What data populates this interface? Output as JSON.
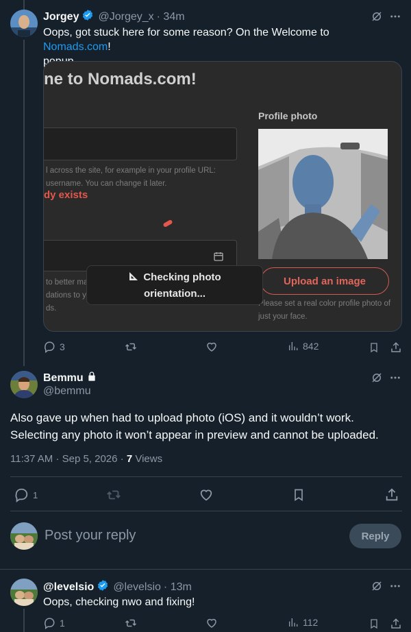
{
  "tweet1": {
    "name": "Jorgey",
    "handle": "@Jorgey_x",
    "time": "· 34m",
    "text_before": "Oops, got stuck here for some reason? On the Welcome to ",
    "text_link": "Nomads.com",
    "text_after": "!",
    "text_line2": "popup.",
    "embed": {
      "title": "ne to Nomads.com!",
      "help_1a": "l across the site, for example in your profile URL:",
      "help_1b": "username. You can change it later.",
      "error": "dy exists",
      "help_2a": "to better ma",
      "help_2b": "dations to yo",
      "help_2c": "ds.",
      "profile_photo_label": "Profile photo",
      "toast_line1": "Checking photo",
      "toast_line2": "orientation...",
      "upload_button": "Upload an image",
      "photo_help": "Please set a real color profile photo of just your face."
    },
    "replies": "3",
    "views": "842"
  },
  "tweet2": {
    "name": "Bemmu",
    "handle": "@bemmu",
    "text": "Also gave up when had to upload photo (iOS) and it wouldn’t work. Selecting any photo it won’t appear in preview and cannot be uploaded.",
    "timestamp": "11:37 AM · Sep 5, 2026 · ",
    "views_count": "7",
    "views_label": " Views",
    "replies": "1"
  },
  "reply_box": {
    "placeholder": "Post your reply",
    "button": "Reply"
  },
  "tweet3": {
    "name": "@levelsio",
    "handle": "@levelsio",
    "time": "· 13m",
    "text": "Oops, checking nwo and fixing!",
    "replies": "1",
    "views": "112"
  },
  "colors": {
    "background": "#15202b",
    "accent": "#1d9bf0",
    "muted": "#8b98a5",
    "error": "#e4574c"
  }
}
